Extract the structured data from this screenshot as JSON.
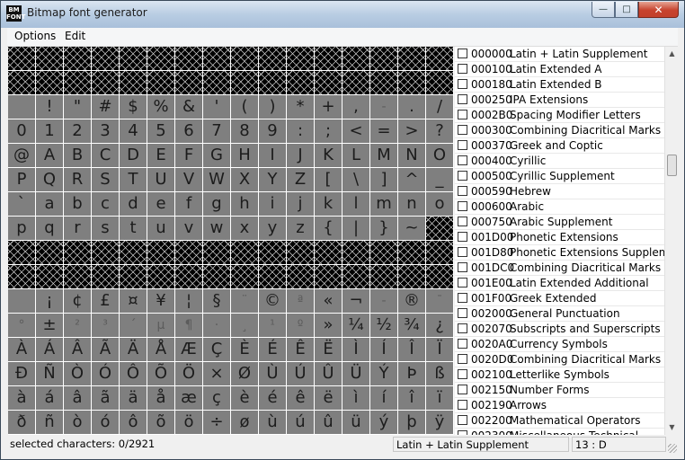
{
  "window": {
    "title": "Bitmap font generator",
    "icon_text": "BM FONT"
  },
  "controls": {
    "minimize": "—",
    "maximize": "□",
    "close": "✕"
  },
  "menu": [
    {
      "label": "Options"
    },
    {
      "label": "Edit"
    }
  ],
  "grid": {
    "rows": [
      [
        "",
        "",
        "",
        "",
        "",
        "",
        "",
        "",
        "",
        "",
        "",
        "",
        "",
        "",
        "",
        ""
      ],
      [
        "",
        "",
        "",
        "",
        "",
        "",
        "",
        "",
        "",
        "",
        "",
        "",
        "",
        "",
        "",
        ""
      ],
      [
        " ",
        "!",
        "\"",
        "#",
        "$",
        "%",
        "&",
        "'",
        "(",
        ")",
        "*",
        "+",
        ",",
        "-",
        ".",
        "/"
      ],
      [
        "0",
        "1",
        "2",
        "3",
        "4",
        "5",
        "6",
        "7",
        "8",
        "9",
        ":",
        ";",
        "<",
        "=",
        ">",
        "?"
      ],
      [
        "@",
        "A",
        "B",
        "C",
        "D",
        "E",
        "F",
        "G",
        "H",
        "I",
        "J",
        "K",
        "L",
        "M",
        "N",
        "O"
      ],
      [
        "P",
        "Q",
        "R",
        "S",
        "T",
        "U",
        "V",
        "W",
        "X",
        "Y",
        "Z",
        "[",
        "\\",
        "]",
        "^",
        "_"
      ],
      [
        "`",
        "a",
        "b",
        "c",
        "d",
        "e",
        "f",
        "g",
        "h",
        "i",
        "j",
        "k",
        "l",
        "m",
        "n",
        "o"
      ],
      [
        "p",
        "q",
        "r",
        "s",
        "t",
        "u",
        "v",
        "w",
        "x",
        "y",
        "z",
        "{",
        "|",
        "}",
        "~",
        ""
      ],
      [
        "",
        "",
        "",
        "",
        "",
        "",
        "",
        "",
        "",
        "",
        "",
        "",
        "",
        "",
        "",
        ""
      ],
      [
        "",
        "",
        "",
        "",
        "",
        "",
        "",
        "",
        "",
        "",
        "",
        "",
        "",
        "",
        "",
        ""
      ],
      [
        " ",
        "¡",
        "¢",
        "£",
        "¤",
        "¥",
        "¦",
        "§",
        "¨",
        "©",
        "ª",
        "«",
        "¬",
        "-",
        "®",
        "¯"
      ],
      [
        "°",
        "±",
        "²",
        "³",
        "´",
        "µ",
        "¶",
        "·",
        "¸",
        "¹",
        "º",
        "»",
        "¼",
        "½",
        "¾",
        "¿"
      ],
      [
        "À",
        "Á",
        "Â",
        "Ã",
        "Ä",
        "Å",
        "Æ",
        "Ç",
        "È",
        "É",
        "Ê",
        "Ë",
        "Ì",
        "Í",
        "Î",
        "Ï"
      ],
      [
        "Ð",
        "Ñ",
        "Ò",
        "Ó",
        "Ô",
        "Õ",
        "Ö",
        "×",
        "Ø",
        "Ù",
        "Ú",
        "Û",
        "Ü",
        "Ý",
        "Þ",
        "ß"
      ],
      [
        "à",
        "á",
        "â",
        "ã",
        "ä",
        "å",
        "æ",
        "ç",
        "è",
        "é",
        "ê",
        "ë",
        "ì",
        "í",
        "î",
        "ï"
      ],
      [
        "ð",
        "ñ",
        "ò",
        "ó",
        "ô",
        "õ",
        "ö",
        "÷",
        "ø",
        "ù",
        "ú",
        "û",
        "ü",
        "ý",
        "þ",
        "ÿ"
      ]
    ]
  },
  "ranges": [
    {
      "code": "000000",
      "name": "Latin + Latin Supplement"
    },
    {
      "code": "000100",
      "name": "Latin Extended A"
    },
    {
      "code": "000180",
      "name": "Latin Extended B"
    },
    {
      "code": "000250",
      "name": "IPA Extensions"
    },
    {
      "code": "0002B0",
      "name": "Spacing Modifier Letters"
    },
    {
      "code": "000300",
      "name": "Combining Diacritical Marks"
    },
    {
      "code": "000370",
      "name": "Greek and Coptic"
    },
    {
      "code": "000400",
      "name": "Cyrillic"
    },
    {
      "code": "000500",
      "name": "Cyrillic Supplement"
    },
    {
      "code": "000590",
      "name": "Hebrew"
    },
    {
      "code": "000600",
      "name": "Arabic"
    },
    {
      "code": "000750",
      "name": "Arabic Supplement"
    },
    {
      "code": "001D00",
      "name": "Phonetic Extensions"
    },
    {
      "code": "001D80",
      "name": "Phonetic Extensions Supplement"
    },
    {
      "code": "001DC0",
      "name": "Combining Diacritical Marks Supplement"
    },
    {
      "code": "001E00",
      "name": "Latin Extended Additional"
    },
    {
      "code": "001F00",
      "name": "Greek Extended"
    },
    {
      "code": "002000",
      "name": "General Punctuation"
    },
    {
      "code": "002070",
      "name": "Subscripts and Superscripts"
    },
    {
      "code": "0020A0",
      "name": "Currency Symbols"
    },
    {
      "code": "0020D0",
      "name": "Combining Diacritical Marks for Symbols"
    },
    {
      "code": "002100",
      "name": "Letterlike Symbols"
    },
    {
      "code": "002150",
      "name": "Number Forms"
    },
    {
      "code": "002190",
      "name": "Arrows"
    },
    {
      "code": "002200",
      "name": "Mathematical Operators"
    },
    {
      "code": "002300",
      "name": "Miscellaneous Technical"
    }
  ],
  "scrollbar": {
    "up": "▲",
    "down": "▼"
  },
  "status": {
    "selected": "selected characters: 0/2921",
    "current_range": "Latin + Latin Supplement",
    "position": "13 : D"
  }
}
